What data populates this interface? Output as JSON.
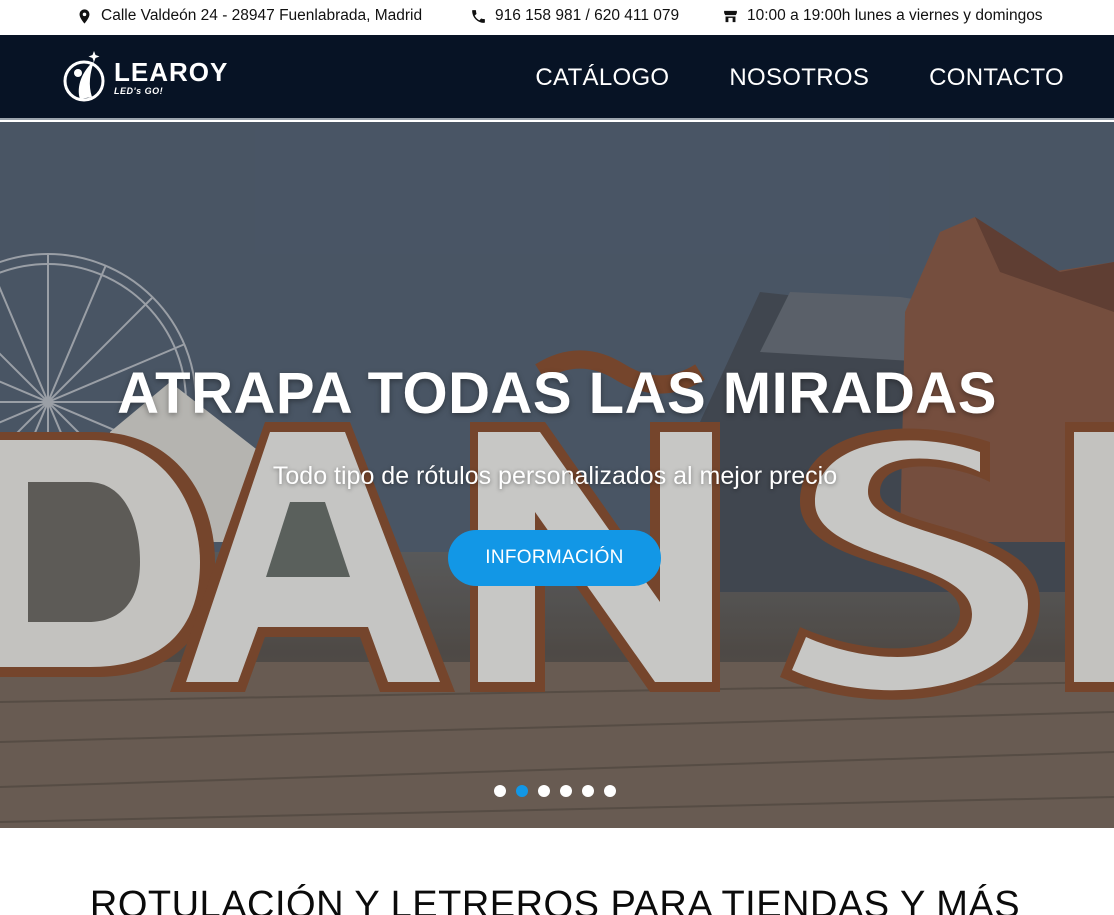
{
  "topbar": {
    "address": "Calle Valdeón 24 - 28947 Fuenlabrada, Madrid",
    "phone": "916 158 981 / 620 411 079",
    "hours": "10:00 a 19:00h lunes a viernes y domingos",
    "icons": [
      "map-pin-icon",
      "phone-icon",
      "store-icon"
    ]
  },
  "header": {
    "logo_name": "LEAROY",
    "logo_tagline": "LED's GO!",
    "nav": [
      {
        "label": "CATÁLOGO"
      },
      {
        "label": "NOSOTROS"
      },
      {
        "label": "CONTACTO"
      }
    ]
  },
  "hero": {
    "title": "ATRAPA TODAS LAS MIRADAS",
    "subtitle": "Todo tipo de rótulos personalizados al mejor precio",
    "button_label": "INFORMACIÓN",
    "slides_total": 6,
    "active_slide": 2
  },
  "section": {
    "title": "ROTULACIÓN Y LETREROS PARA TIENDAS Y MÁS"
  },
  "colors": {
    "nav_bg": "#071325",
    "accent": "#1297e6",
    "text_light": "#ffffff"
  }
}
